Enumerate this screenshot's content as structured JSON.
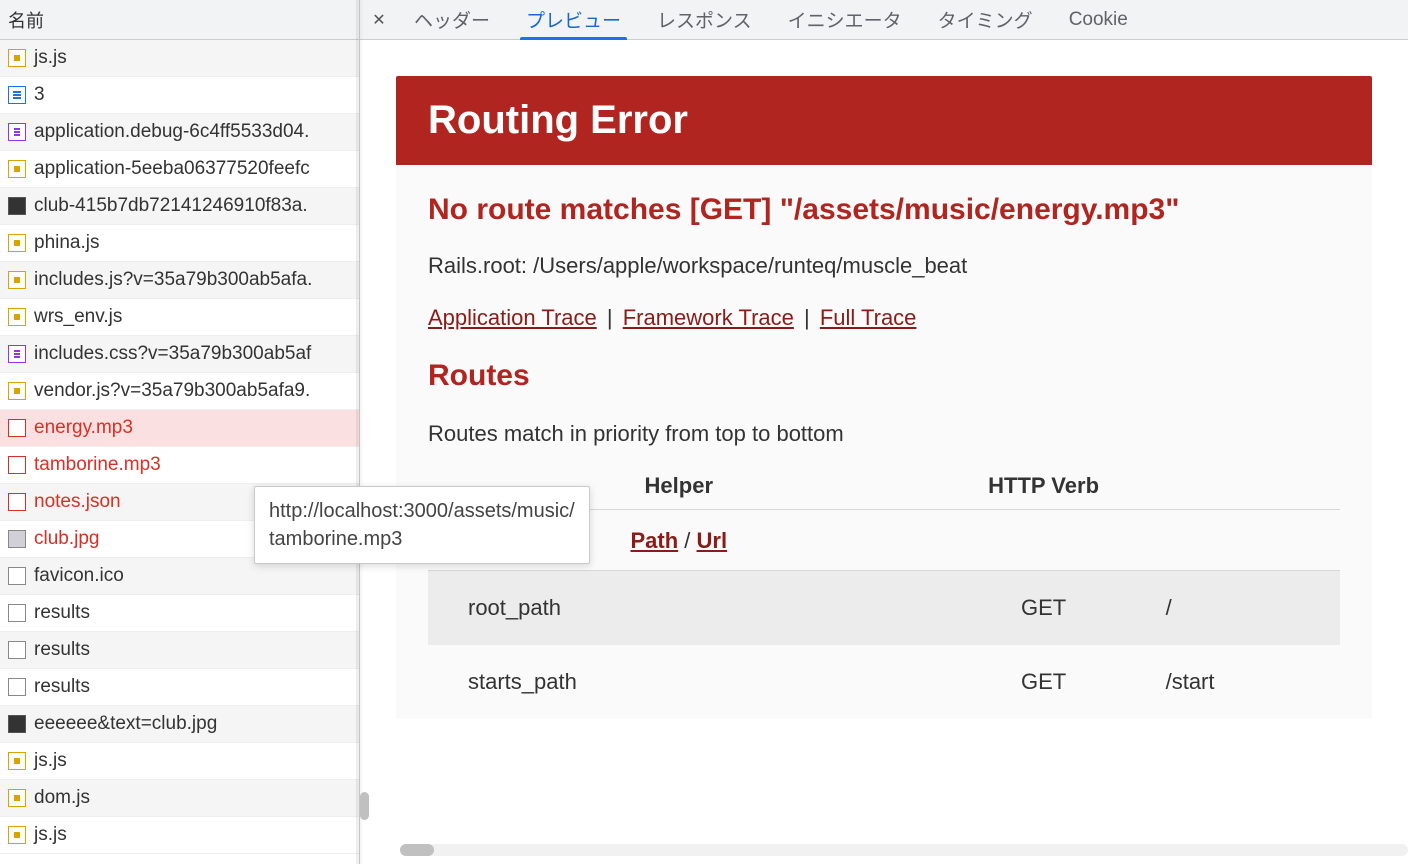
{
  "left": {
    "header": "名前",
    "items": [
      {
        "name": "js.js",
        "icon": "js"
      },
      {
        "name": "3",
        "icon": "doc"
      },
      {
        "name": "application.debug-6c4ff5533d04.",
        "icon": "css"
      },
      {
        "name": "application-5eeba06377520feefc",
        "icon": "js"
      },
      {
        "name": "club-415b7db72141246910f83a.",
        "icon": "img"
      },
      {
        "name": "phina.js",
        "icon": "js"
      },
      {
        "name": "includes.js?v=35a79b300ab5afa.",
        "icon": "js"
      },
      {
        "name": "wrs_env.js",
        "icon": "js"
      },
      {
        "name": "includes.css?v=35a79b300ab5af",
        "icon": "css"
      },
      {
        "name": "vendor.js?v=35a79b300ab5afa9.",
        "icon": "js"
      },
      {
        "name": "energy.mp3",
        "icon": "err",
        "error": true,
        "selected": true
      },
      {
        "name": "tamborine.mp3",
        "icon": "err",
        "error": true
      },
      {
        "name": "notes.json",
        "icon": "err",
        "error": true
      },
      {
        "name": "club.jpg",
        "icon": "imgerr",
        "error": true
      },
      {
        "name": "favicon.ico",
        "icon": "other"
      },
      {
        "name": "results",
        "icon": "other"
      },
      {
        "name": "results",
        "icon": "other"
      },
      {
        "name": "results",
        "icon": "other"
      },
      {
        "name": "eeeeee&text=club.jpg",
        "icon": "img"
      },
      {
        "name": "js.js",
        "icon": "js"
      },
      {
        "name": "dom.js",
        "icon": "js"
      },
      {
        "name": "js.js",
        "icon": "js"
      }
    ]
  },
  "tabs": {
    "items": [
      "ヘッダー",
      "プレビュー",
      "レスポンス",
      "イニシエータ",
      "タイミング",
      "Cookie"
    ],
    "active": 1
  },
  "tooltip": "http://localhost:3000/assets/music/\ntamborine.mp3",
  "rails": {
    "title": "Routing Error",
    "message": "No route matches [GET] \"/assets/music/energy.mp3\"",
    "root": "Rails.root: /Users/apple/workspace/runteq/muscle_beat",
    "traces": [
      "Application Trace",
      "Framework Trace",
      "Full Trace"
    ],
    "routes_heading": "Routes",
    "routes_note": "Routes match in priority from top to bottom",
    "columns": [
      "Helper",
      "HTTP Verb",
      ""
    ],
    "sub_links": [
      "Path",
      "Url"
    ],
    "sub_sep": " / ",
    "rows": [
      {
        "helper": "root_path",
        "verb": "GET",
        "path": "/"
      },
      {
        "helper": "starts_path",
        "verb": "GET",
        "path": "/start"
      }
    ]
  }
}
